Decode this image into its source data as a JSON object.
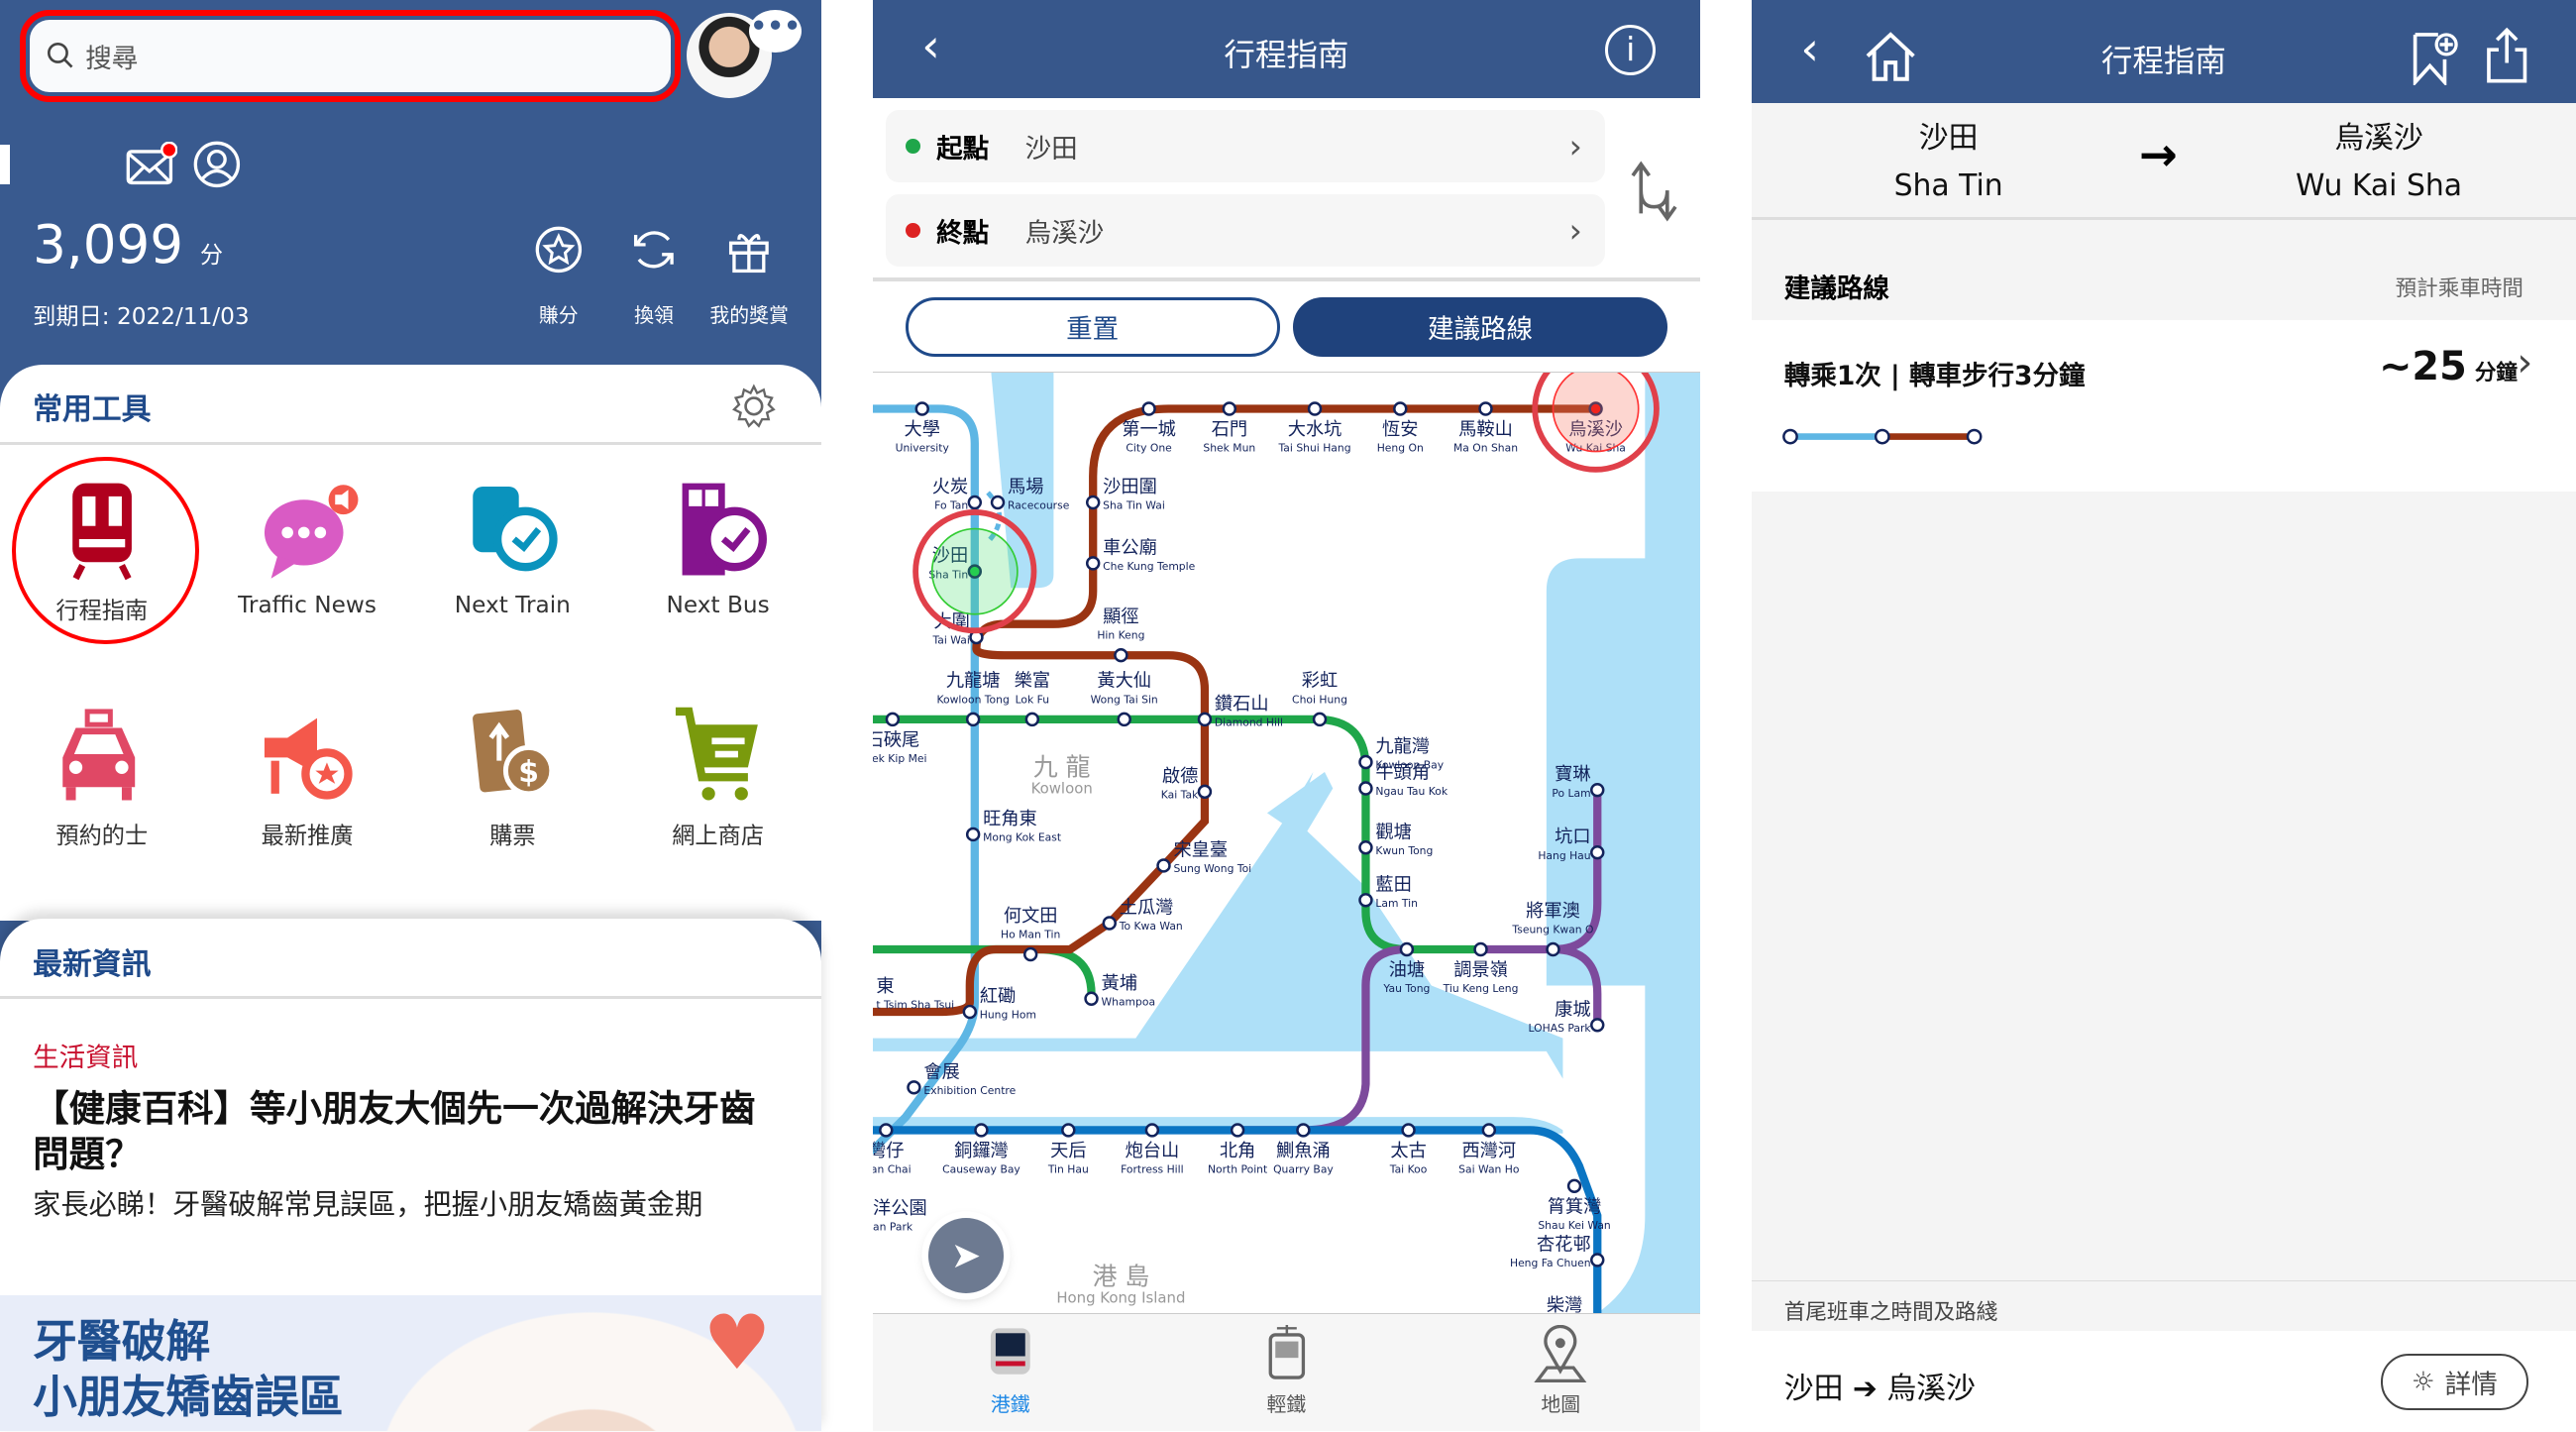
{
  "home": {
    "search_placeholder": "搜尋",
    "points": "3,099",
    "points_unit": "分",
    "expiry": "到期日: 2022/11/03",
    "actions": [
      {
        "label": "賺分",
        "icon": "star-circle-icon"
      },
      {
        "label": "換領",
        "icon": "refresh-icon"
      },
      {
        "label": "我的獎賞",
        "icon": "gift-icon"
      }
    ],
    "tools_title": "常用工具",
    "tools": [
      {
        "label": "行程指南",
        "icon": "train-icon",
        "color": "#b0001e"
      },
      {
        "label": "Traffic News",
        "icon": "chat-bubble-icon",
        "color": "#d95bc4"
      },
      {
        "label": "Next Train",
        "icon": "train-clock-icon",
        "color": "#0a93bd"
      },
      {
        "label": "Next Bus",
        "icon": "bus-clock-icon",
        "color": "#85148e"
      },
      {
        "label": "預約的士",
        "icon": "taxi-icon",
        "color": "#e04865"
      },
      {
        "label": "最新推廣",
        "icon": "megaphone-icon",
        "color": "#f4584b"
      },
      {
        "label": "購票",
        "icon": "ticket-icon",
        "color": "#a57849"
      },
      {
        "label": "網上商店",
        "icon": "cart-icon",
        "color": "#7a9a0d"
      }
    ],
    "news_title": "最新資訊",
    "news_category": "生活資訊",
    "news_headline": "【健康百科】等小朋友大個先一次過解決牙齒問題？",
    "news_summary": "家長必睇！牙醫破解常見誤區，把握小朋友矯齒黃金期",
    "banner_line1": "牙醫破解",
    "banner_line2": "小朋友矯齒誤區"
  },
  "planner": {
    "title": "行程指南",
    "origin_label": "起點",
    "origin_value": "沙田",
    "dest_label": "終點",
    "dest_value": "烏溪沙",
    "reset": "重置",
    "suggest": "建議路線",
    "district_kowloon_zh": "九 龍",
    "district_kowloon_en": "Kowloon",
    "district_island_zh": "港 島",
    "district_island_en": "Hong Kong Island",
    "partial_label": "柴灣",
    "tabs": [
      {
        "label": "港鐵",
        "active": true
      },
      {
        "label": "輕鐵",
        "active": false
      },
      {
        "label": "地圖",
        "active": false
      }
    ],
    "colors": {
      "tuen_ma": "#9a3412",
      "east_rail": "#5eb6e4",
      "kwun_tong": "#1fa64a",
      "tko": "#7d4a9c",
      "island": "#0b75c3",
      "water": "#aee0f8"
    },
    "stations": [
      [
        "烏溪沙",
        "Wu Kai Sha"
      ],
      [
        "馬鞍山",
        "Ma On Shan"
      ],
      [
        "恆安",
        "Heng On"
      ],
      [
        "大水坑",
        "Tai Shui Hang"
      ],
      [
        "石門",
        "Shek Mun"
      ],
      [
        "第一城",
        "City One"
      ],
      [
        "沙田圍",
        "Sha Tin Wai"
      ],
      [
        "車公廟",
        "Che Kung Temple"
      ],
      [
        "大圍",
        "Tai Wai"
      ],
      [
        "顯徑",
        "Hin Keng"
      ],
      [
        "鑽石山",
        "Diamond Hill"
      ],
      [
        "啟德",
        "Kai Tak"
      ],
      [
        "宋皇臺",
        "Sung Wong Toi"
      ],
      [
        "土瓜灣",
        "To Kwa Wan"
      ],
      [
        "何文田",
        "Ho Man Tin"
      ],
      [
        "紅磡",
        "Hung Hom"
      ],
      [
        "東",
        "t Tsim Sha Tsui"
      ],
      [
        "大學",
        "University"
      ],
      [
        "火炭",
        "Fo Tan"
      ],
      [
        "馬場",
        "Racecourse"
      ],
      [
        "沙田",
        "Sha Tin"
      ],
      [
        "九龍塘",
        "Kowloon Tong"
      ],
      [
        "旺角東",
        "Mong Kok East"
      ],
      [
        "會展",
        "Exhibition Centre"
      ],
      [
        "石硤尾",
        "Shek Kip Mei"
      ],
      [
        "樂富",
        "Lok Fu"
      ],
      [
        "黃大仙",
        "Wong Tai Sin"
      ],
      [
        "彩虹",
        "Choi Hung"
      ],
      [
        "九龍灣",
        "Kowloon Bay"
      ],
      [
        "牛頭角",
        "Ngau Tau Kok"
      ],
      [
        "觀塘",
        "Kwun Tong"
      ],
      [
        "藍田",
        "Lam Tin"
      ],
      [
        "油塘",
        "Yau Tong"
      ],
      [
        "調景嶺",
        "Tiu Keng Leng"
      ],
      [
        "黃埔",
        "Whampoa"
      ],
      [
        "寶琳",
        "Po Lam"
      ],
      [
        "坑口",
        "Hang Hau"
      ],
      [
        "將軍澳",
        "Tseung Kwan O"
      ],
      [
        "康城",
        "LOHAS Park"
      ],
      [
        "灣仔",
        "Wan Chai"
      ],
      [
        "銅鑼灣",
        "Causeway Bay"
      ],
      [
        "天后",
        "Tin Hau"
      ],
      [
        "炮台山",
        "Fortress Hill"
      ],
      [
        "北角",
        "North Point"
      ],
      [
        "鰂魚涌",
        "Quarry Bay"
      ],
      [
        "太古",
        "Tai Koo"
      ],
      [
        "西灣河",
        "Sai Wan Ho"
      ],
      [
        "筲箕灣",
        "Shau Kei Wan"
      ],
      [
        "杏花邨",
        "Heng Fa Chuen"
      ],
      [
        "洋公園",
        "an Park"
      ]
    ]
  },
  "result": {
    "title": "行程指南",
    "from_zh": "沙田",
    "from_en": "Sha Tin",
    "to_zh": "烏溪沙",
    "to_en": "Wu Kai Sha",
    "section": "建議路線",
    "section_right": "預計乘車時間",
    "route_summary": "轉乘1次 | 轉車步行3分鐘",
    "duration": "~25",
    "duration_unit": "分鐘",
    "first_last_title": "首尾班車之時間及路綫",
    "first_last_route": "沙田 ➔ 烏溪沙",
    "details": "詳情"
  }
}
